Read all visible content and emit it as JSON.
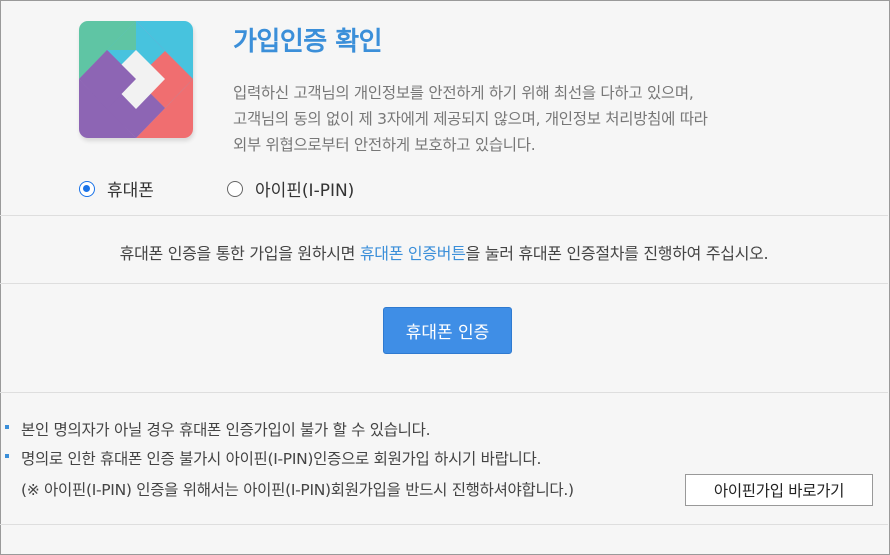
{
  "header": {
    "title": "가입인증 확인",
    "description": [
      "입력하신 고객님의 개인정보를 안전하게 하기 위해 최선을 다하고 있으며,",
      "고객님의 동의 없이 제 3자에게 제공되지 않으며, 개인정보 처리방침에 따라",
      "외부 위협으로부터 안전하게 보호하고 있습니다."
    ],
    "logo_colors": [
      "#5fc5a4",
      "#47c3de",
      "#f06e70",
      "#8d65b4",
      "#e5e5e5"
    ]
  },
  "auth_options": [
    {
      "label": "휴대폰",
      "selected": true
    },
    {
      "label": "아이핀(I-PIN)",
      "selected": false
    }
  ],
  "guide": {
    "prefix": "휴대폰 인증을 통한 가입을 원하시면 ",
    "highlight": "휴대폰 인증버튼",
    "suffix": "을 눌러 휴대폰 인증절차를 진행하여 주십시오."
  },
  "main_button": {
    "label": "휴대폰 인증"
  },
  "notes": [
    "본인 명의자가 아닐 경우 휴대폰 인증가입이 불가 할 수 있습니다.",
    "명의로 인한 휴대폰 인증 불가시 아이핀(I-PIN)인증으로 회원가입 하시기 바랍니다.",
    "(※ 아이핀(I-PIN) 인증을 위해서는 아이핀(I-PIN)회원가입을 반드시 진행하셔야합니다.)"
  ],
  "ipin_button": {
    "label": "아이핀가입 바로가기"
  },
  "colors": {
    "accent": "#3b8fd9",
    "button": "#3f8ee6"
  }
}
